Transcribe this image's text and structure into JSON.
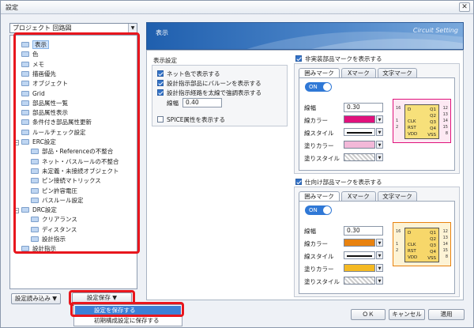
{
  "window": {
    "title": "設定",
    "close": "✕"
  },
  "category": {
    "selected": "プロジェクト 回路図",
    "dropdown": "▼"
  },
  "tree": [
    {
      "label": "表示",
      "level": 0,
      "selected": true
    },
    {
      "label": "色",
      "level": 0
    },
    {
      "label": "メモ",
      "level": 0
    },
    {
      "label": "描画優先",
      "level": 0
    },
    {
      "label": "オブジェクト",
      "level": 0
    },
    {
      "label": "Grid",
      "level": 0
    },
    {
      "label": "部品属性一覧",
      "level": 0
    },
    {
      "label": "部品属性表示",
      "level": 0
    },
    {
      "label": "条件付き部品属性更新",
      "level": 0
    },
    {
      "label": "ルールチェック設定",
      "level": 0
    },
    {
      "label": "ERC設定",
      "level": 0,
      "expander": "−"
    },
    {
      "label": "部品・Referenceの不整合",
      "level": 1
    },
    {
      "label": "ネット・バスルールの不整合",
      "level": 1
    },
    {
      "label": "未定義・未接続オブジェクト",
      "level": 1
    },
    {
      "label": "ピン接続マトリックス",
      "level": 1
    },
    {
      "label": "ピン許容電圧",
      "level": 1
    },
    {
      "label": "バスルール設定",
      "level": 1
    },
    {
      "label": "DRC設定",
      "level": 0,
      "expander": "−"
    },
    {
      "label": "クリアランス",
      "level": 1
    },
    {
      "label": "ディスタンス",
      "level": 1
    },
    {
      "label": "設計指示",
      "level": 1
    },
    {
      "label": "設計指示",
      "level": 0
    }
  ],
  "buttons": {
    "load": "設定読み込み",
    "load_arrow": "▼",
    "save": "設定保存",
    "save_arrow": "▼",
    "ok": "ＯＫ",
    "cancel": "キャンセル",
    "apply": "適用"
  },
  "save_menu": [
    "設定を保存する",
    "初期構成設定に保存する"
  ],
  "header": {
    "title": "表示",
    "subtitle": "Circuit Setting"
  },
  "display": {
    "group_title": "表示設定",
    "net_color": "ネット色で表示する",
    "balloon": "設計指示部品にバルーンを表示する",
    "bold": "設計指示経路を太線で強調表示する",
    "width_label": "線幅",
    "width_value": "0.40",
    "spice": "SPICE属性を表示する"
  },
  "non_mount": {
    "title": "非実装部品マークを表示する",
    "tabs": [
      "囲みマーク",
      "Xマーク",
      "文字マーク"
    ],
    "toggle": "ON",
    "rows": [
      "線幅",
      "線カラー",
      "線スタイル",
      "塗りカラー",
      "塗りスタイル"
    ],
    "width_value": "0.30",
    "line_color": "#e0127c",
    "fill_color": "#f2b8d8"
  },
  "destination": {
    "title": "仕向け部品マークを表示する",
    "tabs": [
      "囲みマーク",
      "Xマーク",
      "文字マーク"
    ],
    "toggle": "ON",
    "rows": [
      "線幅",
      "線カラー",
      "線スタイル",
      "塗りカラー",
      "塗りスタイル"
    ],
    "width_value": "0.30",
    "line_color": "#e8820f",
    "fill_color": "#f4b923"
  },
  "chip": {
    "left": [
      "D",
      "CLK",
      "RST",
      "VDD"
    ],
    "right": [
      "Q1",
      "Q2",
      "Q3",
      "Q4",
      "VSS"
    ],
    "pins_left": [
      "16",
      "1",
      "2"
    ],
    "pins_right": [
      "12",
      "13",
      "14",
      "15",
      "8"
    ],
    "chip_fill_a": "#f7e07a",
    "chip_fill_b": "#f7d76a"
  },
  "colors": {
    "highlight_red": "#e8161d",
    "accent": "#3272c8"
  }
}
